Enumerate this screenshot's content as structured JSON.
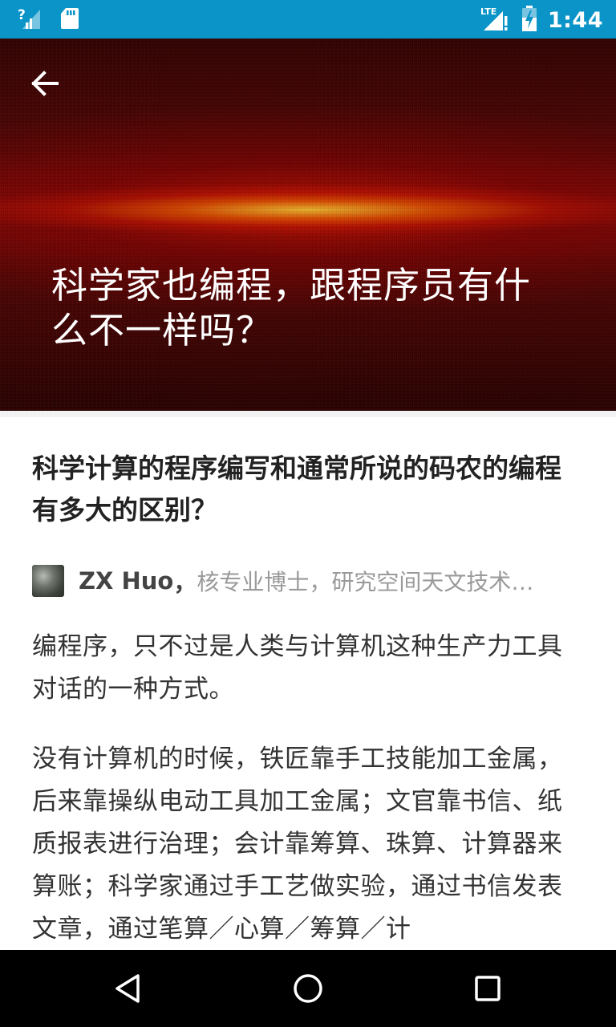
{
  "status_bar": {
    "time": "1:44",
    "network_label": "LTE",
    "background": "#0a94c8",
    "icons": [
      "signal-unknown-icon",
      "sd-card-icon",
      "lte-signal-icon",
      "battery-charging-icon"
    ]
  },
  "hero": {
    "title": "科学家也编程，跟程序员有什么不一样吗？",
    "back_icon": "arrow-left-icon"
  },
  "question": {
    "title": "科学计算的程序编写和通常所说的码农的编程有多大的区别？"
  },
  "answer": {
    "author_name": "ZX Huo",
    "author_separator": "，",
    "author_bio": "核专业博士，研究空间天文技术…",
    "paragraphs": [
      "编程序，只不过是人类与计算机这种生产力工具对话的一种方式。",
      "没有计算机的时候，铁匠靠手工技能加工金属，后来靠操纵电动工具加工金属；文官靠书信、纸质报表进行治理；会计靠筹算、珠算、计算器来算账；科学家通过手工艺做实验，通过书信发表文章，通过笔算／心算／筹算／计"
    ]
  },
  "nav_bar": {
    "icons": [
      "nav-back-icon",
      "nav-home-icon",
      "nav-recents-icon"
    ]
  }
}
